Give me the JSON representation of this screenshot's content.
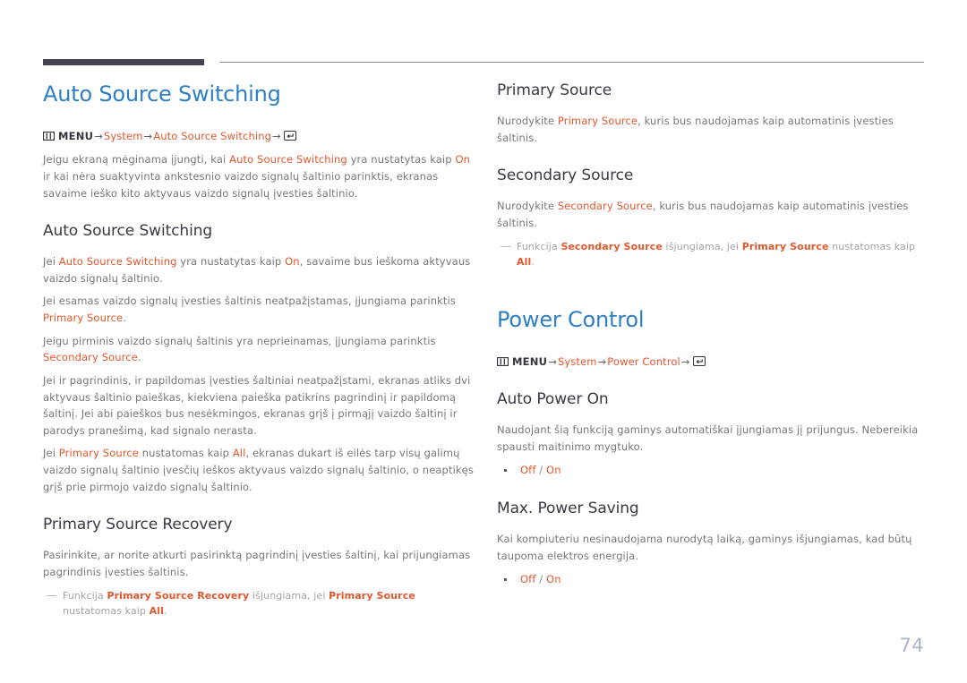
{
  "page": {
    "number": "74",
    "accent_blue": "#2f7fc2",
    "accent_orange": "#e2572d",
    "heading_dark": "#3b3745",
    "body_gray": "#77767c",
    "rule_dark": "#474154"
  },
  "left": {
    "title": "Auto Source Switching",
    "breadcrumb": {
      "menu_icon": "menu-grid-icon",
      "menu_label": "MENU",
      "arrow": "→",
      "crumb1": "System",
      "crumb2": "Auto Source Switching",
      "enter_icon": "enter-key-icon"
    },
    "intro": {
      "part1": "Jeigu ekraną mėginama įjungti, kai ",
      "kw1": "Auto Source Switching",
      "part2": " yra nustatytas kaip ",
      "kw2": "On",
      "part3": " ir kai nėra suaktyvinta ankstesnio vaizdo signalų šaltinio parinktis, ekranas savaime ieško kito aktyvaus vaizdo signalų įvesties šaltinio."
    },
    "section1": {
      "heading": "Auto Source Switching",
      "p1": {
        "part1": "Jei ",
        "kw1": "Auto Source Switching",
        "part2": " yra nustatytas kaip ",
        "kw2": "On",
        "part3": ", savaime bus ieškoma aktyvaus vaizdo signalų šaltinio."
      },
      "p2": {
        "part1": "Jei esamas vaizdo signalų įvesties šaltinis neatpažįstamas, įjungiama parinktis ",
        "kw1": "Primary Source",
        "part2": "."
      },
      "p3": {
        "part1": "Jeigu pirminis vaizdo signalų šaltinis yra neprieinamas, įjungiama parinktis ",
        "kw1": "Secondary Source",
        "part2": "."
      },
      "p4": "Jei ir pagrindinis, ir papildomas įvesties šaltiniai neatpažįstami, ekranas atliks dvi aktyvaus šaltinio paieškas, kiekviena paieška patikrins pagrindinį ir papildomą šaltinį. Jei abi paieškos bus nesėkmingos, ekranas grįš į pirmąjį vaizdo šaltinį ir parodys pranešimą, kad signalo nerasta.",
      "p5": {
        "part1": "Jei ",
        "kw1": "Primary Source",
        "part2": " nustatomas kaip ",
        "kw2": "All",
        "part3": ", ekranas dukart iš eilės tarp visų galimų vaizdo signalų šaltinio įvesčių ieškos aktyvaus vaizdo signalų šaltinio, o neaptikęs grįš prie pirmojo vaizdo signalų šaltinio."
      }
    },
    "section2": {
      "heading": "Primary Source Recovery",
      "p1": "Pasirinkite, ar norite atkurti pasirinktą pagrindinį įvesties šaltinį, kai prijungiamas pagrindinis įvesties šaltinis.",
      "note": {
        "part1": "Funkcija ",
        "kw1": "Primary Source Recovery",
        "part2": " išjungiama, jei ",
        "kw2": "Primary Source",
        "part3": " nustatomas kaip ",
        "kw3": "All",
        "part4": "."
      }
    }
  },
  "right": {
    "section1": {
      "heading": "Primary Source",
      "p1": {
        "part1": "Nurodykite ",
        "kw1": "Primary Source",
        "part2": ", kuris bus naudojamas kaip automatinis įvesties šaltinis."
      }
    },
    "section2": {
      "heading": "Secondary Source",
      "p1": {
        "part1": "Nurodykite ",
        "kw1": "Secondary Source",
        "part2": ", kuris bus naudojamas kaip automatinis įvesties šaltinis."
      },
      "note": {
        "part1": "Funkcija ",
        "kw1": "Secondary Source",
        "part2": " išjungiama, jei ",
        "kw2": "Primary Source",
        "part3": " nustatomas kaip ",
        "kw3": "All",
        "part4": "."
      }
    },
    "title": "Power Control",
    "breadcrumb": {
      "menu_icon": "menu-grid-icon",
      "menu_label": "MENU",
      "arrow": "→",
      "crumb1": "System",
      "crumb2": "Power Control",
      "enter_icon": "enter-key-icon"
    },
    "section3": {
      "heading": "Auto Power On",
      "p1": "Naudojant šią funkciją gaminys automatiškai įjungiamas jį prijungus. Nebereikia spausti maitinimo mygtuko.",
      "bullet": {
        "opt1": "Off",
        "sep": " / ",
        "opt2": "On"
      }
    },
    "section4": {
      "heading": "Max. Power Saving",
      "p1": "Kai kompiuteriu nesinaudojama nurodytą laiką, gaminys išjungiamas, kad būtų taupoma elektros energija.",
      "bullet": {
        "opt1": "Off",
        "sep": " / ",
        "opt2": "On"
      }
    }
  }
}
